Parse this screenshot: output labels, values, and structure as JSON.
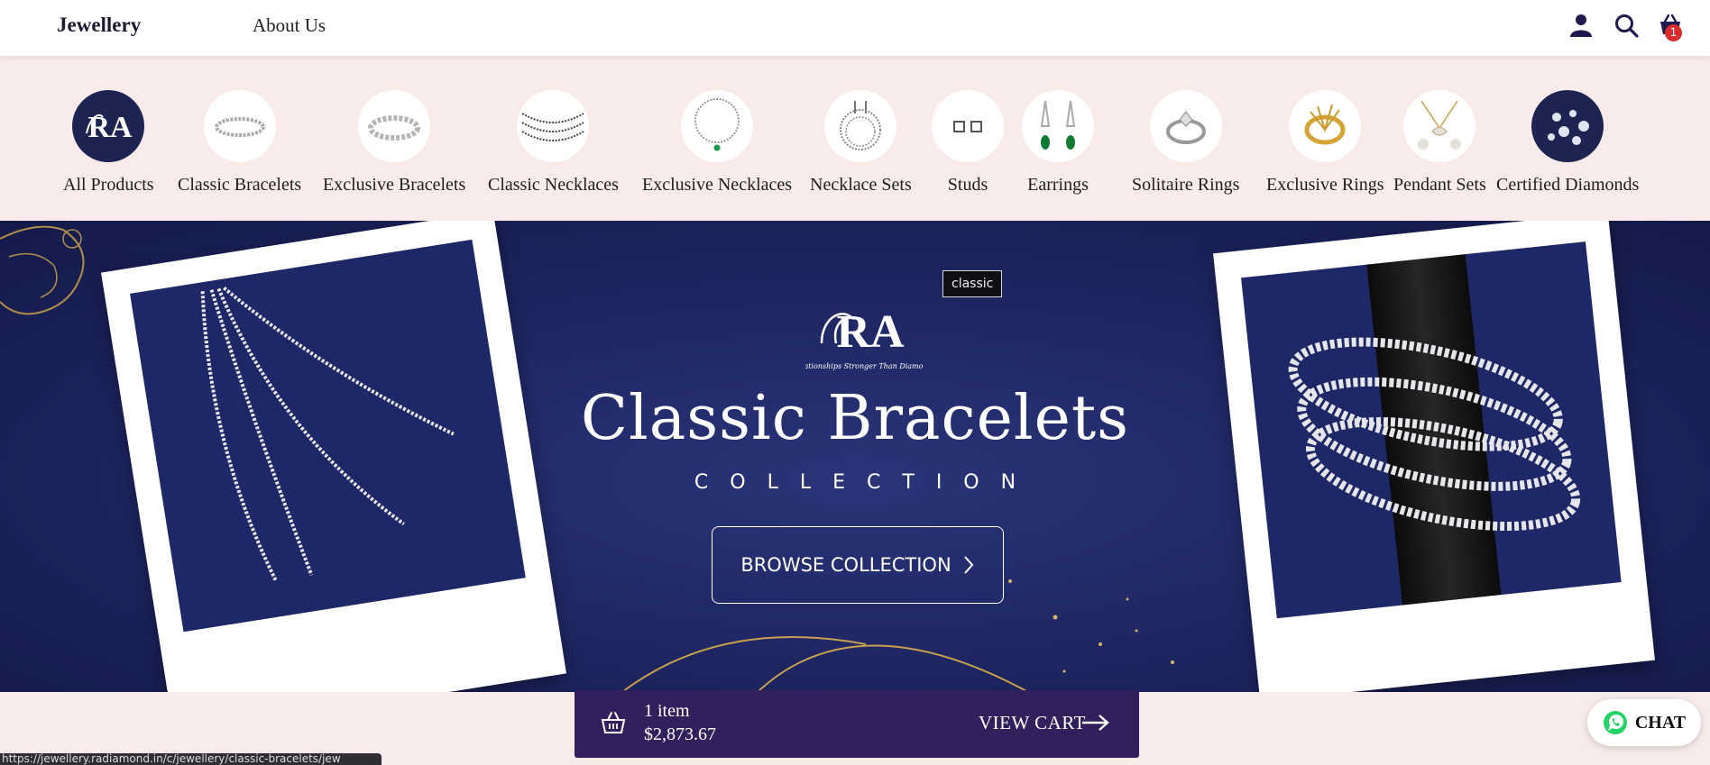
{
  "header": {
    "brand": "Jewellery",
    "nav_about": "About Us",
    "cart_count": "1",
    "icons": [
      "user-icon",
      "search-icon",
      "basket-icon"
    ]
  },
  "categories": [
    {
      "label": "All Products",
      "icon": "ra-logo"
    },
    {
      "label": "Classic Bracelets",
      "icon": "bracelet"
    },
    {
      "label": "Exclusive Bracelets",
      "icon": "bracelet"
    },
    {
      "label": "Classic Necklaces",
      "icon": "necklace"
    },
    {
      "label": "Exclusive Necklaces",
      "icon": "necklace"
    },
    {
      "label": "Necklace Sets",
      "icon": "necklace-set"
    },
    {
      "label": "Studs",
      "icon": "studs"
    },
    {
      "label": "Earrings",
      "icon": "earrings"
    },
    {
      "label": "Solitaire Rings",
      "icon": "ring"
    },
    {
      "label": "Exclusive Rings",
      "icon": "ring"
    },
    {
      "label": "Pendant Sets",
      "icon": "pendant"
    },
    {
      "label": "Certified Diamonds",
      "icon": "diamonds"
    }
  ],
  "hero": {
    "tag": "classic",
    "logo_text": "RA",
    "logo_tagline": "Relationships Stronger Than Diamonds",
    "title": "Classic Bracelets",
    "subtitle": "COLLECTION",
    "button_label": "BROWSE COLLECTION"
  },
  "cart_bar": {
    "item_count": "1 item",
    "total": "$2,873.67",
    "view_label": "VIEW CART"
  },
  "chat": {
    "label": "CHAT"
  },
  "status_url": "https://jewellery.radiamond.in/c/jewellery/classic-bracelets/jew",
  "colors": {
    "hero_bg": "#1d2560",
    "cart_bar": "#32205c",
    "strip_bg": "#f8ebea",
    "badge": "#d92c2c",
    "whatsapp": "#25d366"
  }
}
